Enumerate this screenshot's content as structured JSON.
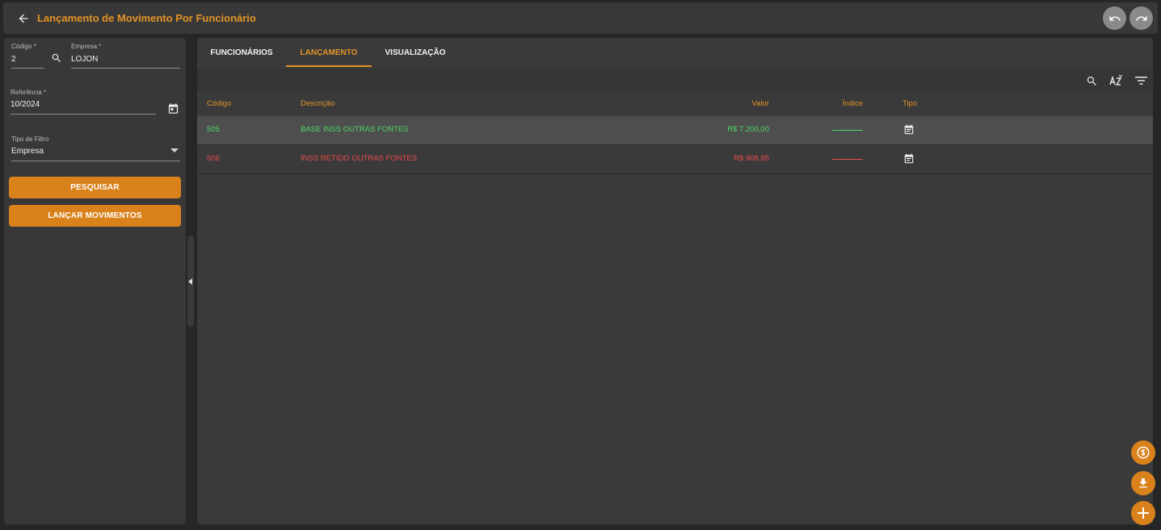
{
  "header": {
    "title": "Lançamento de Movimento Por Funcionário"
  },
  "filters": {
    "codigo": {
      "label": "Código *",
      "value": "2"
    },
    "empresa": {
      "label": "Empresa *",
      "value": "LOJON"
    },
    "referencia": {
      "label": "Referência *",
      "value": "10/2024"
    },
    "tipo_filtro": {
      "label": "Tipo de Filtro",
      "value": "Empresa"
    },
    "search_button": "PESQUISAR",
    "launch_button": "LANÇAR MOVIMENTOS"
  },
  "tabs": [
    {
      "label": "FUNCIONÁRIOS",
      "active": false
    },
    {
      "label": "LANÇAMENTO",
      "active": true
    },
    {
      "label": "VISUALIZAÇÃO",
      "active": false
    }
  ],
  "grid": {
    "columns": [
      "Código",
      "Descrição",
      "Valor",
      "Índice",
      "Tipo"
    ],
    "rows": [
      {
        "codigo": "505",
        "descricao": "BASE INSS OUTRAS FONTES",
        "valor": "R$ 7.200,00",
        "color": "#4cd964",
        "selected": true
      },
      {
        "codigo": "506",
        "descricao": "INSS RETIDO OUTRAS FONTES",
        "valor": "R$ 908,85",
        "color": "#ef4b4b",
        "selected": false
      }
    ]
  },
  "colors": {
    "accent": "#e39325",
    "button": "#d9821c",
    "positive": "#4cd964",
    "negative": "#ef4b4b"
  }
}
